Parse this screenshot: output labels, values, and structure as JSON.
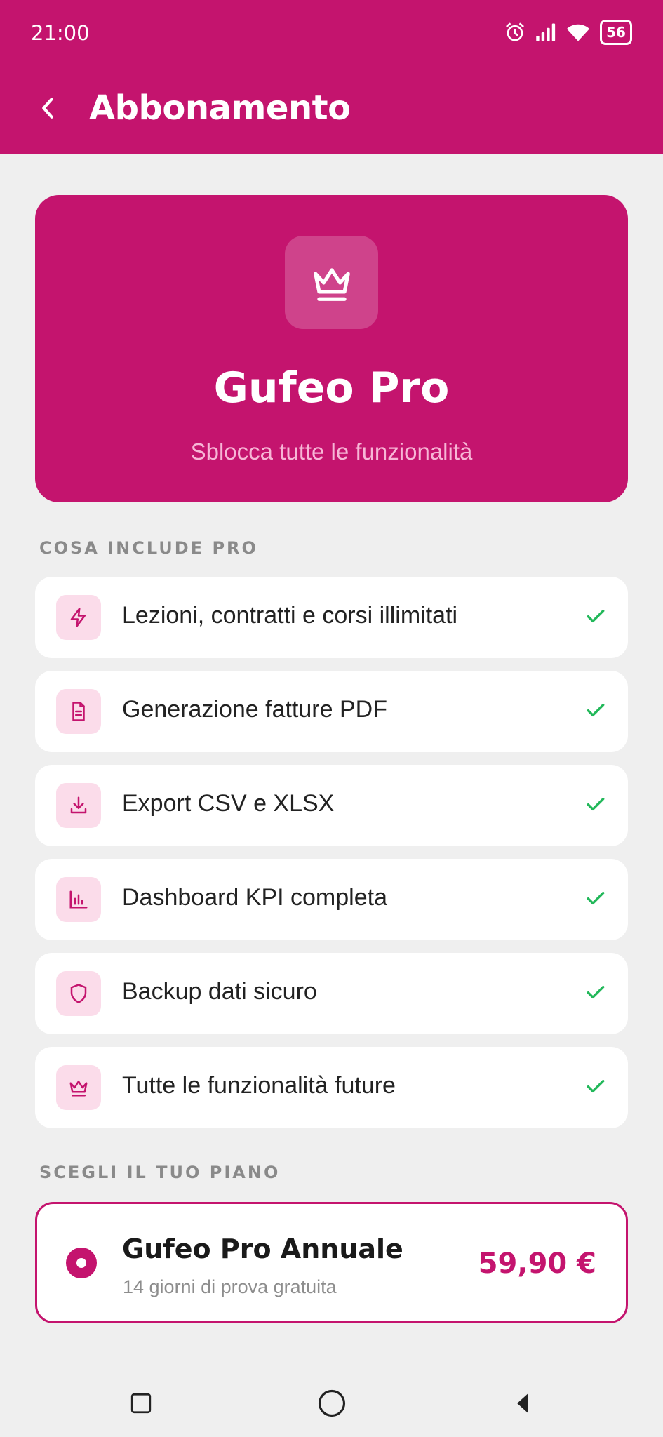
{
  "status_bar": {
    "time": "21:00",
    "battery": "56",
    "icons": [
      "alarm-icon",
      "signal-icon",
      "wifi-icon",
      "battery-icon"
    ]
  },
  "app_bar": {
    "title": "Abbonamento",
    "back_icon": "chevron-left-icon"
  },
  "hero": {
    "icon": "crown-icon",
    "title": "Gufeo Pro",
    "subtitle": "Sblocca tutte le funzionalità"
  },
  "features_section": {
    "label": "COSA INCLUDE PRO",
    "items": [
      {
        "icon": "lightning-icon",
        "label": "Lezioni, contratti e corsi illimitati",
        "included": true
      },
      {
        "icon": "document-icon",
        "label": "Generazione fatture PDF",
        "included": true
      },
      {
        "icon": "download-icon",
        "label": "Export CSV e XLSX",
        "included": true
      },
      {
        "icon": "bar-chart-icon",
        "label": "Dashboard KPI completa",
        "included": true
      },
      {
        "icon": "shield-icon",
        "label": "Backup dati sicuro",
        "included": true
      },
      {
        "icon": "crown-icon",
        "label": "Tutte le funzionalità future",
        "included": true
      }
    ]
  },
  "plan_section": {
    "label": "SCEGLI IL TUO PIANO",
    "plan": {
      "name": "Gufeo Pro Annuale",
      "note": "14 giorni di prova gratuita",
      "price": "59,90 €",
      "selected": true
    }
  },
  "colors": {
    "primary": "#c4146e",
    "check": "#22b85a",
    "background": "#efefef",
    "icon_bg": "#fbdcea"
  }
}
